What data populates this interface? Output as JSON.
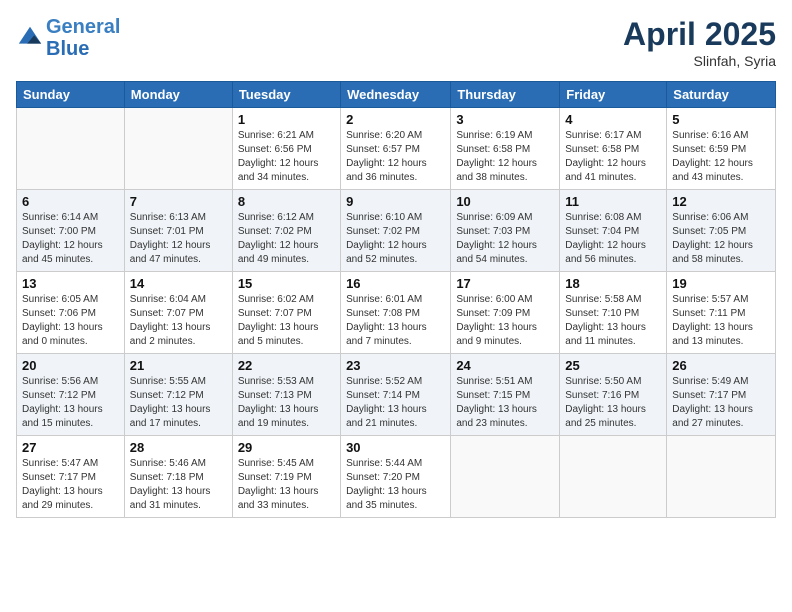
{
  "header": {
    "logo_line1": "General",
    "logo_line2": "Blue",
    "month": "April 2025",
    "location": "Slinfah, Syria"
  },
  "weekdays": [
    "Sunday",
    "Monday",
    "Tuesday",
    "Wednesday",
    "Thursday",
    "Friday",
    "Saturday"
  ],
  "weeks": [
    [
      {
        "day": "",
        "info": ""
      },
      {
        "day": "",
        "info": ""
      },
      {
        "day": "1",
        "info": "Sunrise: 6:21 AM\nSunset: 6:56 PM\nDaylight: 12 hours and 34 minutes."
      },
      {
        "day": "2",
        "info": "Sunrise: 6:20 AM\nSunset: 6:57 PM\nDaylight: 12 hours and 36 minutes."
      },
      {
        "day": "3",
        "info": "Sunrise: 6:19 AM\nSunset: 6:58 PM\nDaylight: 12 hours and 38 minutes."
      },
      {
        "day": "4",
        "info": "Sunrise: 6:17 AM\nSunset: 6:58 PM\nDaylight: 12 hours and 41 minutes."
      },
      {
        "day": "5",
        "info": "Sunrise: 6:16 AM\nSunset: 6:59 PM\nDaylight: 12 hours and 43 minutes."
      }
    ],
    [
      {
        "day": "6",
        "info": "Sunrise: 6:14 AM\nSunset: 7:00 PM\nDaylight: 12 hours and 45 minutes."
      },
      {
        "day": "7",
        "info": "Sunrise: 6:13 AM\nSunset: 7:01 PM\nDaylight: 12 hours and 47 minutes."
      },
      {
        "day": "8",
        "info": "Sunrise: 6:12 AM\nSunset: 7:02 PM\nDaylight: 12 hours and 49 minutes."
      },
      {
        "day": "9",
        "info": "Sunrise: 6:10 AM\nSunset: 7:02 PM\nDaylight: 12 hours and 52 minutes."
      },
      {
        "day": "10",
        "info": "Sunrise: 6:09 AM\nSunset: 7:03 PM\nDaylight: 12 hours and 54 minutes."
      },
      {
        "day": "11",
        "info": "Sunrise: 6:08 AM\nSunset: 7:04 PM\nDaylight: 12 hours and 56 minutes."
      },
      {
        "day": "12",
        "info": "Sunrise: 6:06 AM\nSunset: 7:05 PM\nDaylight: 12 hours and 58 minutes."
      }
    ],
    [
      {
        "day": "13",
        "info": "Sunrise: 6:05 AM\nSunset: 7:06 PM\nDaylight: 13 hours and 0 minutes."
      },
      {
        "day": "14",
        "info": "Sunrise: 6:04 AM\nSunset: 7:07 PM\nDaylight: 13 hours and 2 minutes."
      },
      {
        "day": "15",
        "info": "Sunrise: 6:02 AM\nSunset: 7:07 PM\nDaylight: 13 hours and 5 minutes."
      },
      {
        "day": "16",
        "info": "Sunrise: 6:01 AM\nSunset: 7:08 PM\nDaylight: 13 hours and 7 minutes."
      },
      {
        "day": "17",
        "info": "Sunrise: 6:00 AM\nSunset: 7:09 PM\nDaylight: 13 hours and 9 minutes."
      },
      {
        "day": "18",
        "info": "Sunrise: 5:58 AM\nSunset: 7:10 PM\nDaylight: 13 hours and 11 minutes."
      },
      {
        "day": "19",
        "info": "Sunrise: 5:57 AM\nSunset: 7:11 PM\nDaylight: 13 hours and 13 minutes."
      }
    ],
    [
      {
        "day": "20",
        "info": "Sunrise: 5:56 AM\nSunset: 7:12 PM\nDaylight: 13 hours and 15 minutes."
      },
      {
        "day": "21",
        "info": "Sunrise: 5:55 AM\nSunset: 7:12 PM\nDaylight: 13 hours and 17 minutes."
      },
      {
        "day": "22",
        "info": "Sunrise: 5:53 AM\nSunset: 7:13 PM\nDaylight: 13 hours and 19 minutes."
      },
      {
        "day": "23",
        "info": "Sunrise: 5:52 AM\nSunset: 7:14 PM\nDaylight: 13 hours and 21 minutes."
      },
      {
        "day": "24",
        "info": "Sunrise: 5:51 AM\nSunset: 7:15 PM\nDaylight: 13 hours and 23 minutes."
      },
      {
        "day": "25",
        "info": "Sunrise: 5:50 AM\nSunset: 7:16 PM\nDaylight: 13 hours and 25 minutes."
      },
      {
        "day": "26",
        "info": "Sunrise: 5:49 AM\nSunset: 7:17 PM\nDaylight: 13 hours and 27 minutes."
      }
    ],
    [
      {
        "day": "27",
        "info": "Sunrise: 5:47 AM\nSunset: 7:17 PM\nDaylight: 13 hours and 29 minutes."
      },
      {
        "day": "28",
        "info": "Sunrise: 5:46 AM\nSunset: 7:18 PM\nDaylight: 13 hours and 31 minutes."
      },
      {
        "day": "29",
        "info": "Sunrise: 5:45 AM\nSunset: 7:19 PM\nDaylight: 13 hours and 33 minutes."
      },
      {
        "day": "30",
        "info": "Sunrise: 5:44 AM\nSunset: 7:20 PM\nDaylight: 13 hours and 35 minutes."
      },
      {
        "day": "",
        "info": ""
      },
      {
        "day": "",
        "info": ""
      },
      {
        "day": "",
        "info": ""
      }
    ]
  ]
}
